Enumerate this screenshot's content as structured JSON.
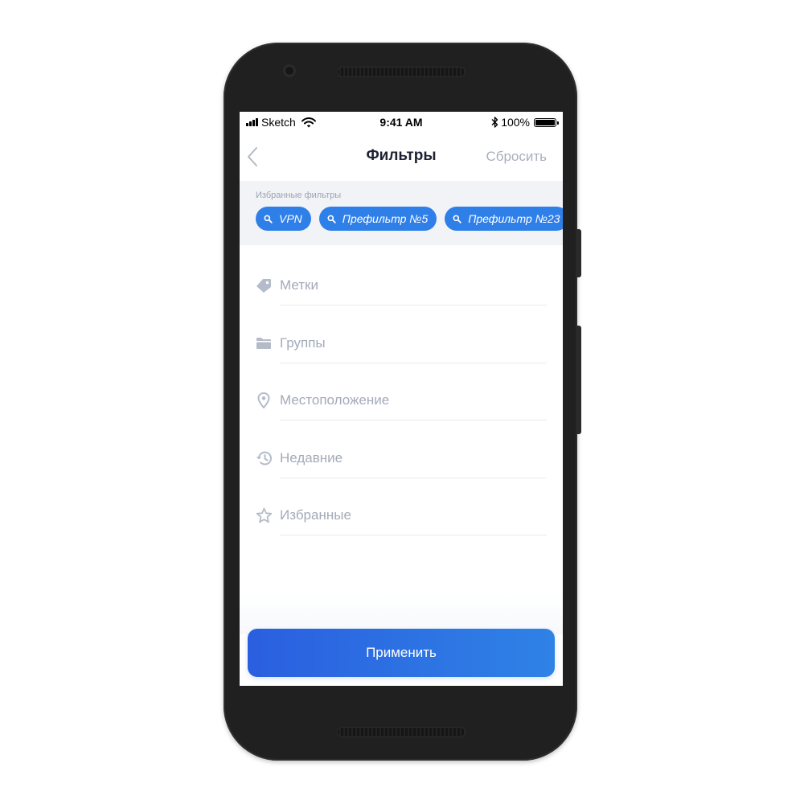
{
  "status_bar": {
    "carrier": "Sketch",
    "time": "9:41 AM",
    "battery": "100%"
  },
  "nav": {
    "title": "Фильтры",
    "reset_label": "Сбросить",
    "back_icon": "chevron-left-icon"
  },
  "favorites": {
    "label": "Избранные фильтры",
    "chips": [
      {
        "label": "VPN",
        "icon": "search-icon"
      },
      {
        "label": "Префильтр №5",
        "icon": "search-icon"
      },
      {
        "label": "Префильтр №23",
        "icon": "search-icon"
      }
    ]
  },
  "filters": [
    {
      "label": "Метки",
      "icon": "tag-icon"
    },
    {
      "label": "Группы",
      "icon": "folder-icon"
    },
    {
      "label": "Местоположение",
      "icon": "location-pin-icon"
    },
    {
      "label": "Недавние",
      "icon": "history-icon"
    },
    {
      "label": "Избранные",
      "icon": "star-icon"
    }
  ],
  "apply_label": "Применить",
  "colors": {
    "accent": "#2f7fe9",
    "title": "#1d2233",
    "muted": "#a3aab8",
    "strip_bg": "#f1f3f7"
  }
}
